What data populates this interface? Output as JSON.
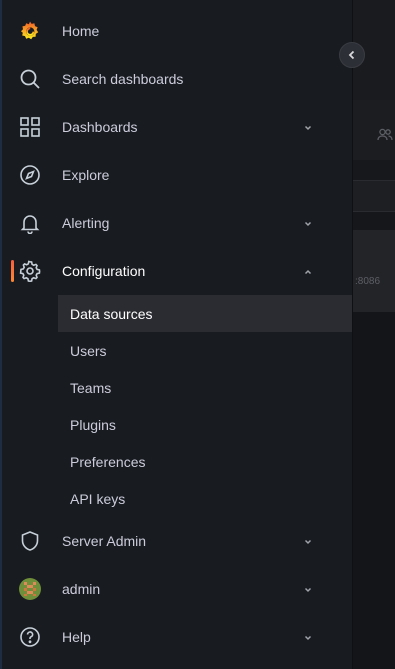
{
  "nav": {
    "home": {
      "label": "Home",
      "icon": "grafana-logo-icon"
    },
    "search": {
      "label": "Search dashboards",
      "icon": "search-icon"
    },
    "dashboards": {
      "label": "Dashboards",
      "icon": "apps-grid-icon"
    },
    "explore": {
      "label": "Explore",
      "icon": "compass-icon"
    },
    "alerting": {
      "label": "Alerting",
      "icon": "bell-icon"
    },
    "configuration": {
      "label": "Configuration",
      "icon": "gear-icon",
      "expanded": true,
      "children": [
        {
          "label": "Data sources",
          "selected": true
        },
        {
          "label": "Users"
        },
        {
          "label": "Teams"
        },
        {
          "label": "Plugins"
        },
        {
          "label": "Preferences"
        },
        {
          "label": "API keys"
        }
      ]
    },
    "server_admin": {
      "label": "Server Admin",
      "icon": "shield-icon"
    },
    "admin": {
      "label": "admin",
      "icon": "avatar"
    },
    "help": {
      "label": "Help",
      "icon": "question-circle-icon"
    }
  },
  "background": {
    "port_text": ":8086"
  },
  "colors": {
    "sidebar_bg": "#181b1f",
    "selected_bg": "#2b2c31",
    "accent": "#f55f3e",
    "text": "#ccccdc"
  }
}
